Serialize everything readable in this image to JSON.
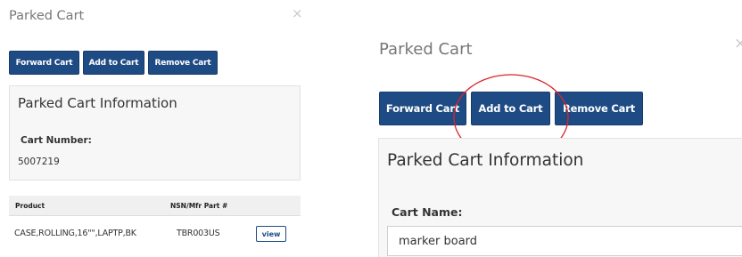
{
  "left_panel": {
    "title": "Parked Cart",
    "close_glyph": "×",
    "buttons": {
      "forward": "Forward Cart",
      "add": "Add to Cart",
      "remove": "Remove Cart"
    },
    "info": {
      "heading": "Parked Cart Information",
      "cart_number_label": "Cart Number:",
      "cart_number_value": "5007219"
    },
    "table": {
      "columns": [
        "Product",
        "NSN/Mfr Part #"
      ],
      "rows": [
        {
          "product": "CASE,ROLLING,16\"\",LAPTP,BK",
          "part": "TBR003US",
          "action": "view"
        }
      ]
    }
  },
  "right_panel": {
    "title": "Parked Cart",
    "close_glyph": "×",
    "buttons": {
      "forward": "Forward Cart",
      "add": "Add to Cart",
      "remove": "Remove Cart"
    },
    "info": {
      "heading": "Parked Cart Information",
      "cart_name_label": "Cart Name:",
      "cart_name_value": "marker board"
    }
  },
  "colors": {
    "button_bg": "#1f4b84",
    "highlight_circle": "#d9262c"
  }
}
